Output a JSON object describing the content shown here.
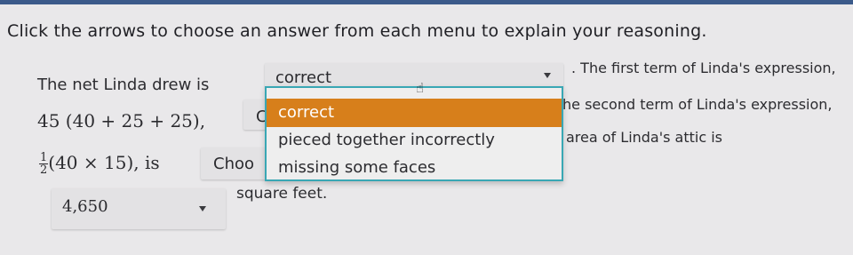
{
  "instruction": "Click the arrows to choose an answer from each menu to explain your reasoning.",
  "line1": {
    "prefix": "The net Linda drew is",
    "suffix": ". The first term of Linda's expression,"
  },
  "line2": {
    "expression": "45 (40 + 25 + 25),",
    "partial_dropdown_text": "C",
    "suffix": "he second term of Linda's expression,"
  },
  "line3": {
    "fraction": {
      "numerator": "1",
      "denominator": "2"
    },
    "expression": "(40 × 15), is",
    "partial_dropdown_text": "Choo",
    "suffix": "area of Linda's attic is"
  },
  "line4": {
    "value": "4,650",
    "suffix": "square feet."
  },
  "dropdown_net": {
    "value": "correct",
    "options": [
      "correct",
      "pieced together incorrectly",
      "missing some faces"
    ],
    "highlighted_index": 0
  }
}
